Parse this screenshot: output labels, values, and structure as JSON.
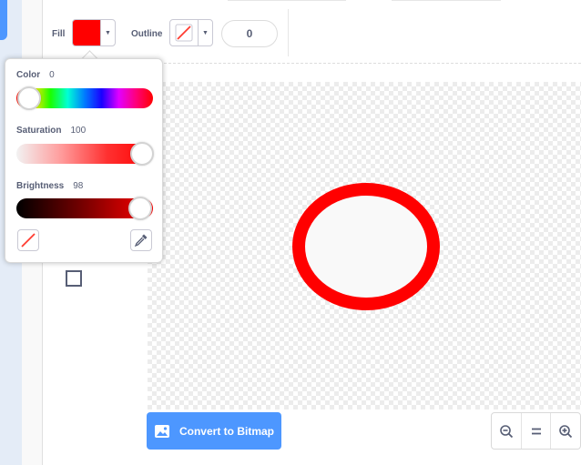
{
  "toolbar": {
    "fill_label": "Fill",
    "fill_color": "#ff0000",
    "outline_label": "Outline",
    "outline_width": "0"
  },
  "color_picker": {
    "color_label": "Color",
    "color_value": "0",
    "saturation_label": "Saturation",
    "saturation_value": "100",
    "brightness_label": "Brightness",
    "brightness_value": "98",
    "color_level": 0,
    "saturation_level": 100,
    "brightness_level": 98
  },
  "canvas": {
    "shape": "ellipse",
    "stroke_color": "#ff0000",
    "fill_color": "#f9f9f9"
  },
  "bottom": {
    "convert_label": "Convert to Bitmap",
    "zoom_out_icon": "zoom-out-icon",
    "zoom_reset_icon": "zoom-reset-icon",
    "zoom_in_icon": "zoom-in-icon"
  },
  "colors": {
    "accent": "#4d97ff",
    "text": "#575e75"
  }
}
